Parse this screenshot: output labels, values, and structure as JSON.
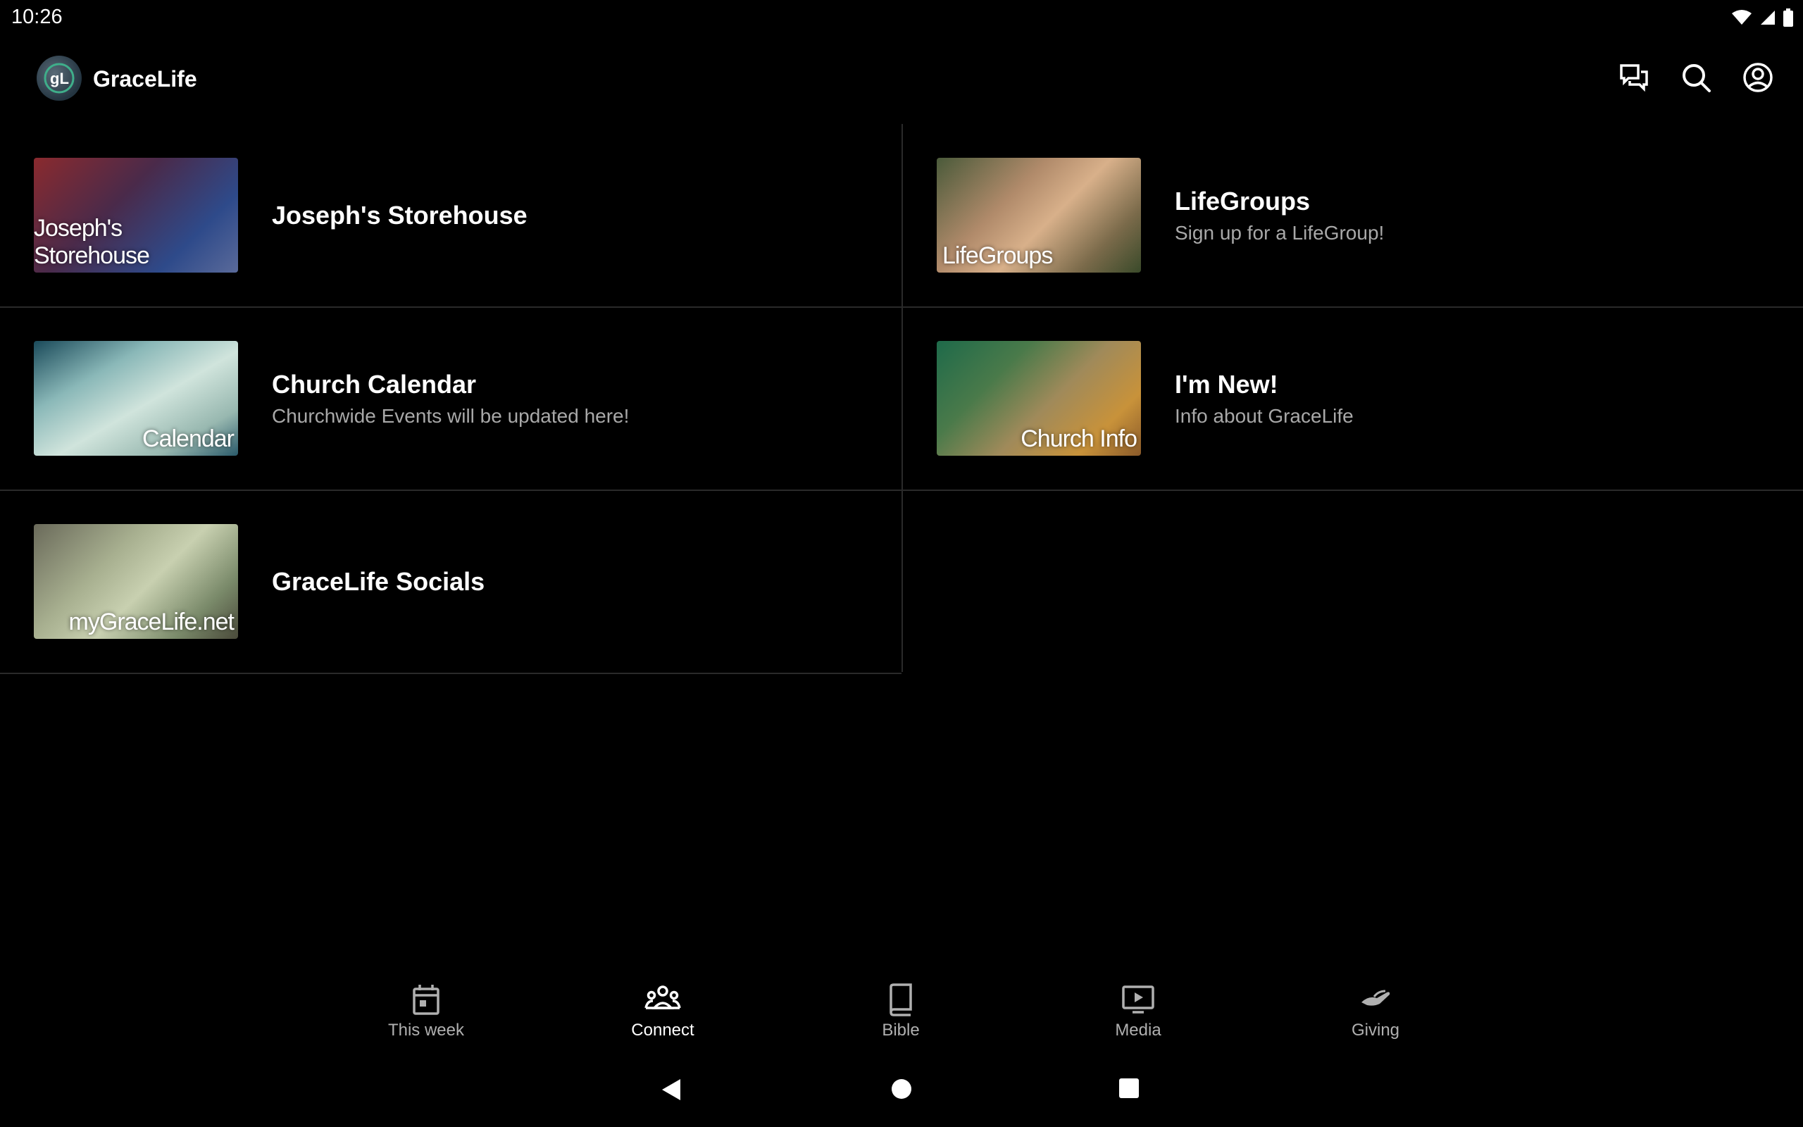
{
  "status_bar": {
    "time": "10:26"
  },
  "app": {
    "title": "GraceLife",
    "logo_text": "gL"
  },
  "appbar_actions": [
    {
      "name": "chat-icon"
    },
    {
      "name": "search-icon"
    },
    {
      "name": "account-icon"
    }
  ],
  "tiles": [
    {
      "title": "Joseph's Storehouse",
      "subtitle": "",
      "thumb_label": "Joseph's Storehouse",
      "thumb_colors": [
        "#7a1f2a",
        "#3a4a8a"
      ]
    },
    {
      "title": "LifeGroups",
      "subtitle": "Sign up for a LifeGroup!",
      "thumb_label": "LifeGroups",
      "thumb_colors": [
        "#6b7a4a",
        "#c8a07a"
      ]
    },
    {
      "title": "Church Calendar",
      "subtitle": "Churchwide Events will be updated here!",
      "thumb_label": "Calendar",
      "thumb_colors": [
        "#1f5a6a",
        "#b8d0c8"
      ]
    },
    {
      "title": "I'm New!",
      "subtitle": "Info about GraceLife",
      "thumb_label": "Church Info",
      "thumb_colors": [
        "#2a6a4a",
        "#c89a3a"
      ]
    },
    {
      "title": "GraceLife Socials",
      "subtitle": "",
      "thumb_label": "myGraceLife.net",
      "thumb_colors": [
        "#5a6a5a",
        "#a8b89a"
      ]
    }
  ],
  "bottom_nav": [
    {
      "label": "This week",
      "icon": "calendar-icon",
      "active": false
    },
    {
      "label": "Connect",
      "icon": "people-icon",
      "active": true
    },
    {
      "label": "Bible",
      "icon": "book-icon",
      "active": false
    },
    {
      "label": "Media",
      "icon": "media-icon",
      "active": false
    },
    {
      "label": "Giving",
      "icon": "giving-icon",
      "active": false
    }
  ],
  "colors": {
    "background": "#000000",
    "divider": "#2a2a2a",
    "subtitle": "#a8a8a8",
    "nav_inactive": "#b0b0b0",
    "nav_active": "#ffffff"
  }
}
